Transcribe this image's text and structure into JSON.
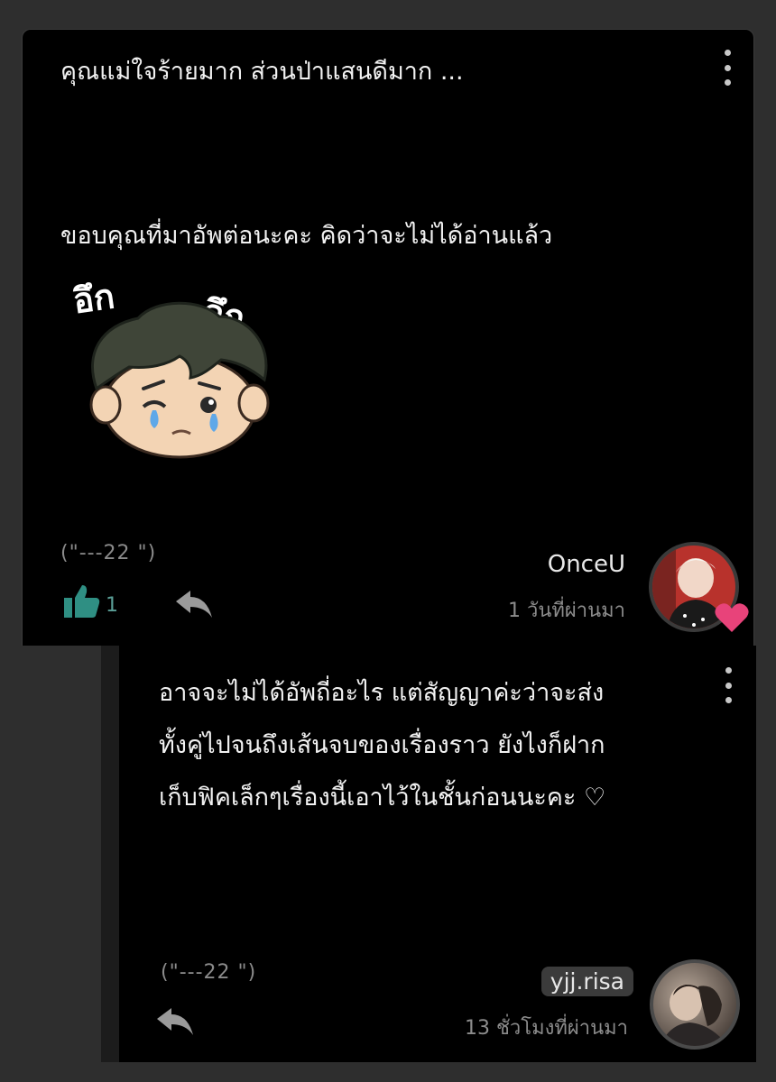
{
  "main_comment": {
    "line1": "คุณแม่ใจร้ายมาก ส่วนป่าแสนดีมาก ...",
    "line2": "ขอบคุณที่มาอัพต่อนะคะ คิดว่าจะไม่ได้อ่านแล้ว",
    "sticker_text_1": "อึก",
    "sticker_text_2": "อึก",
    "chapter_ref": "(\"---22 \")",
    "like_count": "1",
    "username": "OnceU",
    "time": "1 วันที่ผ่านมา",
    "colors": {
      "like": "#2f8f83",
      "heart": "#e8437a"
    }
  },
  "reply_comment": {
    "lines": [
      "อาจจะไม่ได้อัพถี่อะไร แต่สัญญาค่ะว่าจะส่ง",
      "ทั้งคู่ไปจนถึงเส้นจบของเรื่องราว ยังไงก็ฝาก",
      "เก็บฟิคเล็กๆเรื่องนี้เอาไว้ในชั้นก่อนนะคะ ♡"
    ],
    "chapter_ref": "(\"---22 \")",
    "username": "yjj.risa",
    "time": "13 ชั่วโมงที่ผ่านมา"
  }
}
